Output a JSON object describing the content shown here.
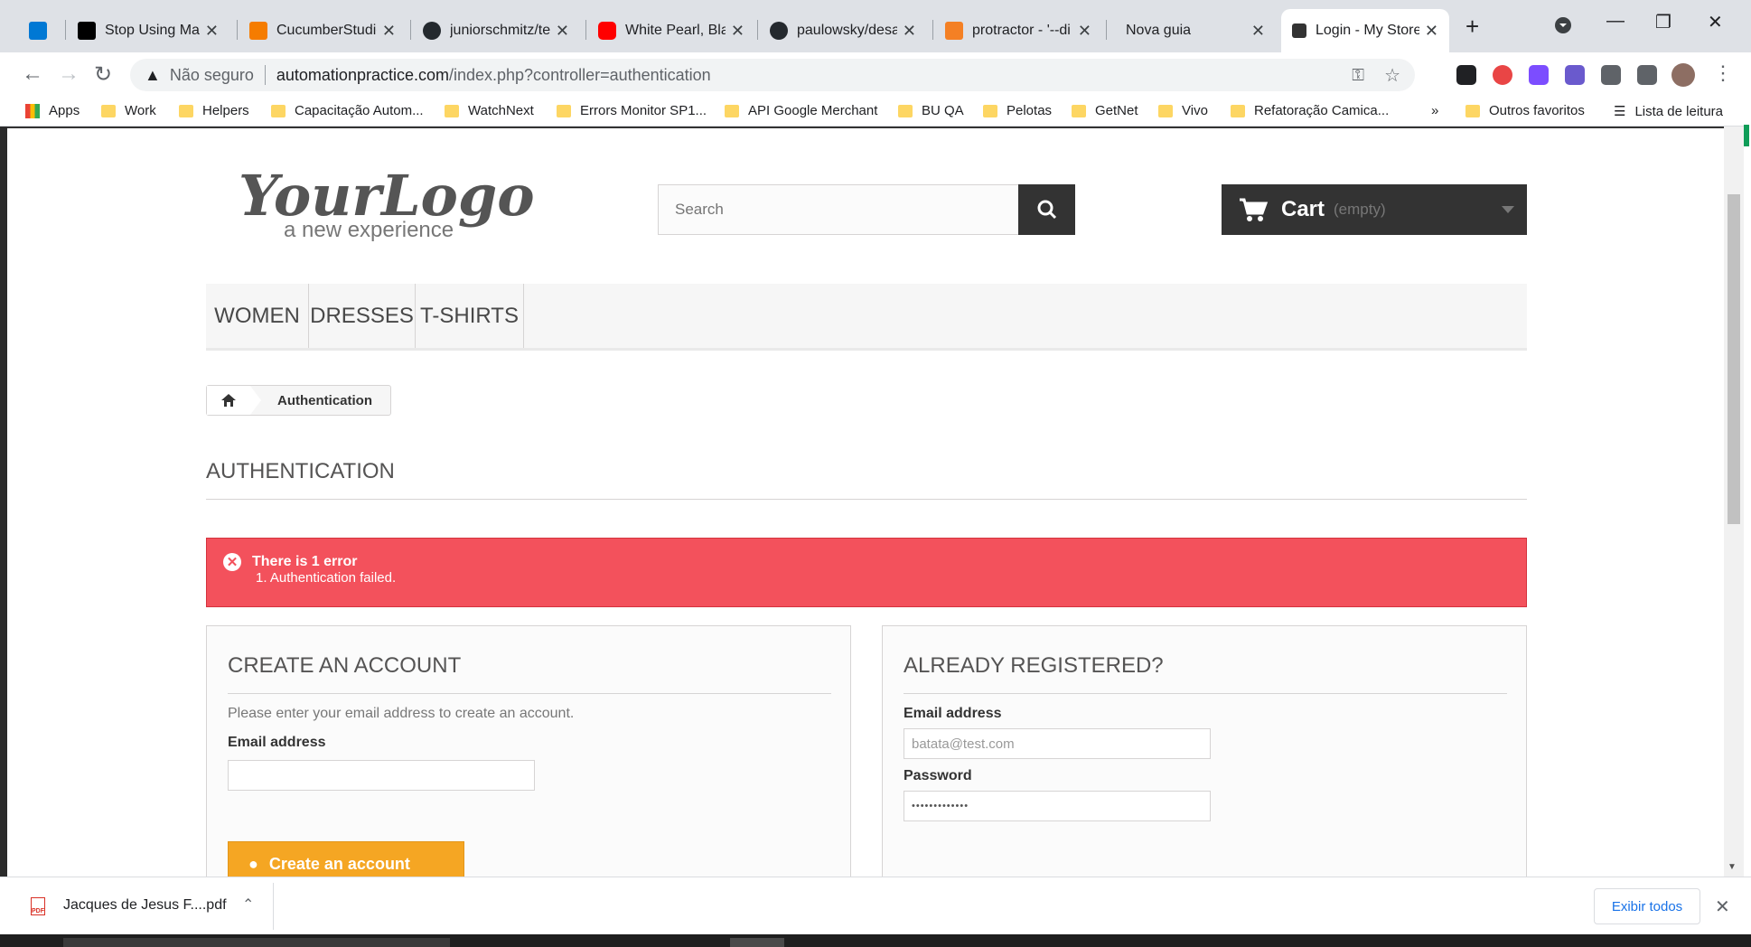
{
  "browser": {
    "tabs": [
      {
        "title": "",
        "favicon_color": "#0078d4",
        "active": false
      },
      {
        "title": "Stop Using Magi",
        "favicon_color": "#000000",
        "active": false
      },
      {
        "title": "CucumberStudio",
        "favicon_color": "#f57c00",
        "active": false
      },
      {
        "title": "juniorschmitz/tes",
        "favicon_color": "#24292e",
        "active": false
      },
      {
        "title": "White Pearl, Blac",
        "favicon_color": "#ff0000",
        "active": false
      },
      {
        "title": "paulowsky/desafi",
        "favicon_color": "#24292e",
        "active": false
      },
      {
        "title": "protractor - '--di",
        "favicon_color": "#f48024",
        "active": false
      },
      {
        "title": "Nova guia",
        "favicon_color": "",
        "active": false
      },
      {
        "title": "Login - My Store",
        "favicon_color": "#333333",
        "active": true
      }
    ],
    "new_tab": "+",
    "address": {
      "security_label": "Não seguro",
      "url_host": "automationpractice.com",
      "url_path": "/index.php?controller=authentication"
    },
    "bookmarks": [
      "Apps",
      "Work",
      "Helpers",
      "Capacitação Autom...",
      "WatchNext",
      "Errors Monitor SP1...",
      "API Google Merchant",
      "BU QA",
      "Pelotas",
      "GetNet",
      "Vivo",
      "Refatoração Camica..."
    ],
    "bookmarks_overflow": "»",
    "other_bookmarks": "Outros favoritos",
    "reading_list": "Lista de leitura"
  },
  "store": {
    "logo_main": "YourLogo",
    "logo_sub": "a new experience",
    "search_placeholder": "Search",
    "cart_label": "Cart",
    "cart_status": "(empty)",
    "menu": [
      "WOMEN",
      "DRESSES",
      "T-SHIRTS"
    ],
    "breadcrumb": "Authentication",
    "page_heading": "AUTHENTICATION",
    "alert": {
      "title": "There is 1 error",
      "items": [
        "Authentication failed."
      ]
    },
    "create_account": {
      "heading": "CREATE AN ACCOUNT",
      "description": "Please enter your email address to create an account.",
      "email_label": "Email address",
      "email_value": "",
      "button_label": "Create an account"
    },
    "login": {
      "heading": "ALREADY REGISTERED?",
      "email_label": "Email address",
      "email_value": "batata@test.com",
      "password_label": "Password",
      "password_value": "•••••••••••••"
    }
  },
  "downloads": {
    "file_name": "Jacques de Jesus F....pdf",
    "file_icon_label": "PDF",
    "show_all": "Exibir todos"
  },
  "colors": {
    "alert_bg": "#f3515c",
    "dark": "#333333",
    "button_orange": "#f5a623"
  }
}
